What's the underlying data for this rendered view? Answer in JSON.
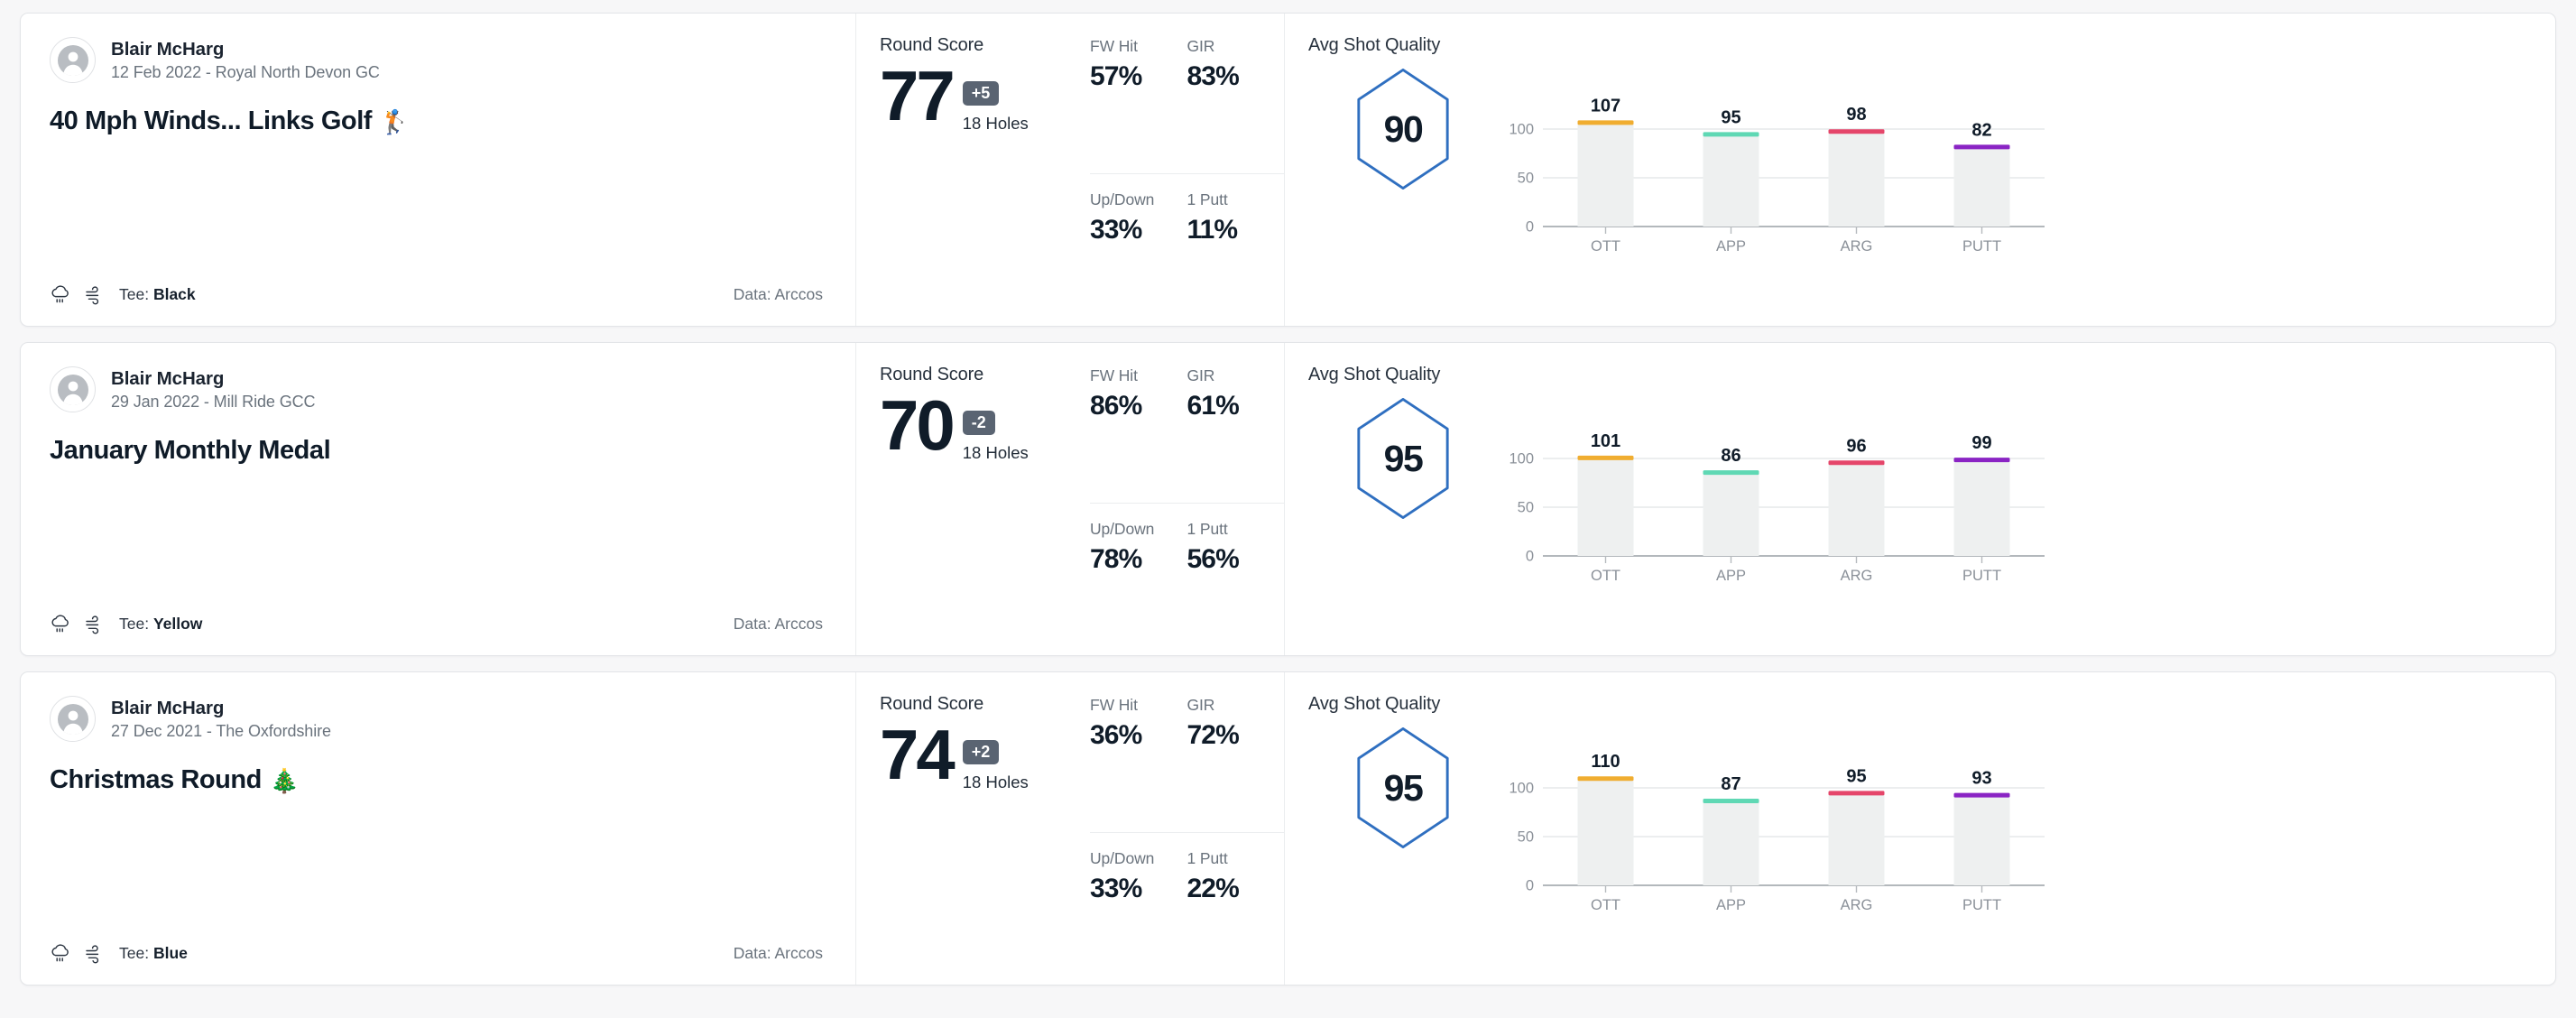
{
  "app": {
    "chart_axis": {
      "y_ticks": [
        "100",
        "50",
        "0"
      ],
      "y_values": [
        100,
        50,
        0
      ],
      "categories": [
        "OTT",
        "APP",
        "ARG",
        "PUTT"
      ],
      "ymax": 125
    },
    "bar_colors": [
      "#f0ad30",
      "#5fd8b4",
      "#e5466a",
      "#8a24c4"
    ],
    "labels": {
      "round_score": "Round Score",
      "holes": "18 Holes",
      "fw_hit": "FW Hit",
      "gir": "GIR",
      "up_down": "Up/Down",
      "one_putt": "1 Putt",
      "avg_shot_quality": "Avg Shot Quality",
      "tee_prefix": "Tee: ",
      "data_prefix": "Data: "
    },
    "accent_hex": "#2f6fc0",
    "badge_bg": "#5a6472"
  },
  "rounds": [
    {
      "player": "Blair McHarg",
      "meta": "12 Feb 2022 - Royal North Devon GC",
      "title": "40 Mph Winds... Links Golf",
      "title_emoji": "🏌️",
      "tee": "Black",
      "tee_label": "Tee: Black",
      "data_source": "Data: Arccos",
      "score": "77",
      "to_par": "+5",
      "holes": "18 Holes",
      "fw_hit": "57%",
      "gir": "83%",
      "up_down": "33%",
      "one_putt": "11%",
      "avg_shot_quality": "90",
      "chart_data": {
        "type": "bar",
        "title": "Avg Shot Quality",
        "categories": [
          "OTT",
          "APP",
          "ARG",
          "PUTT"
        ],
        "values": [
          107,
          95,
          98,
          82
        ],
        "colors": [
          "#f0ad30",
          "#5fd8b4",
          "#e5466a",
          "#8a24c4"
        ],
        "ylim": [
          0,
          125
        ],
        "yticks": [
          0,
          50,
          100
        ],
        "xlabel": "",
        "ylabel": "",
        "grid": true,
        "legend": "none"
      }
    },
    {
      "player": "Blair McHarg",
      "meta": "29 Jan 2022 - Mill Ride GCC",
      "title": "January Monthly Medal",
      "title_emoji": "",
      "tee": "Yellow",
      "tee_label": "Tee: Yellow",
      "data_source": "Data: Arccos",
      "score": "70",
      "to_par": "-2",
      "holes": "18 Holes",
      "fw_hit": "86%",
      "gir": "61%",
      "up_down": "78%",
      "one_putt": "56%",
      "avg_shot_quality": "95",
      "chart_data": {
        "type": "bar",
        "title": "Avg Shot Quality",
        "categories": [
          "OTT",
          "APP",
          "ARG",
          "PUTT"
        ],
        "values": [
          101,
          86,
          96,
          99
        ],
        "colors": [
          "#f0ad30",
          "#5fd8b4",
          "#e5466a",
          "#8a24c4"
        ],
        "ylim": [
          0,
          125
        ],
        "yticks": [
          0,
          50,
          100
        ],
        "xlabel": "",
        "ylabel": "",
        "grid": true,
        "legend": "none"
      }
    },
    {
      "player": "Blair McHarg",
      "meta": "27 Dec 2021 - The Oxfordshire",
      "title": "Christmas Round",
      "title_emoji": "🎄",
      "tee": "Blue",
      "tee_label": "Tee: Blue",
      "data_source": "Data: Arccos",
      "score": "74",
      "to_par": "+2",
      "holes": "18 Holes",
      "fw_hit": "36%",
      "gir": "72%",
      "up_down": "33%",
      "one_putt": "22%",
      "avg_shot_quality": "95",
      "chart_data": {
        "type": "bar",
        "title": "Avg Shot Quality",
        "categories": [
          "OTT",
          "APP",
          "ARG",
          "PUTT"
        ],
        "values": [
          110,
          87,
          95,
          93
        ],
        "colors": [
          "#f0ad30",
          "#5fd8b4",
          "#e5466a",
          "#8a24c4"
        ],
        "ylim": [
          0,
          125
        ],
        "yticks": [
          0,
          50,
          100
        ],
        "xlabel": "",
        "ylabel": "",
        "grid": true,
        "legend": "none"
      }
    }
  ]
}
